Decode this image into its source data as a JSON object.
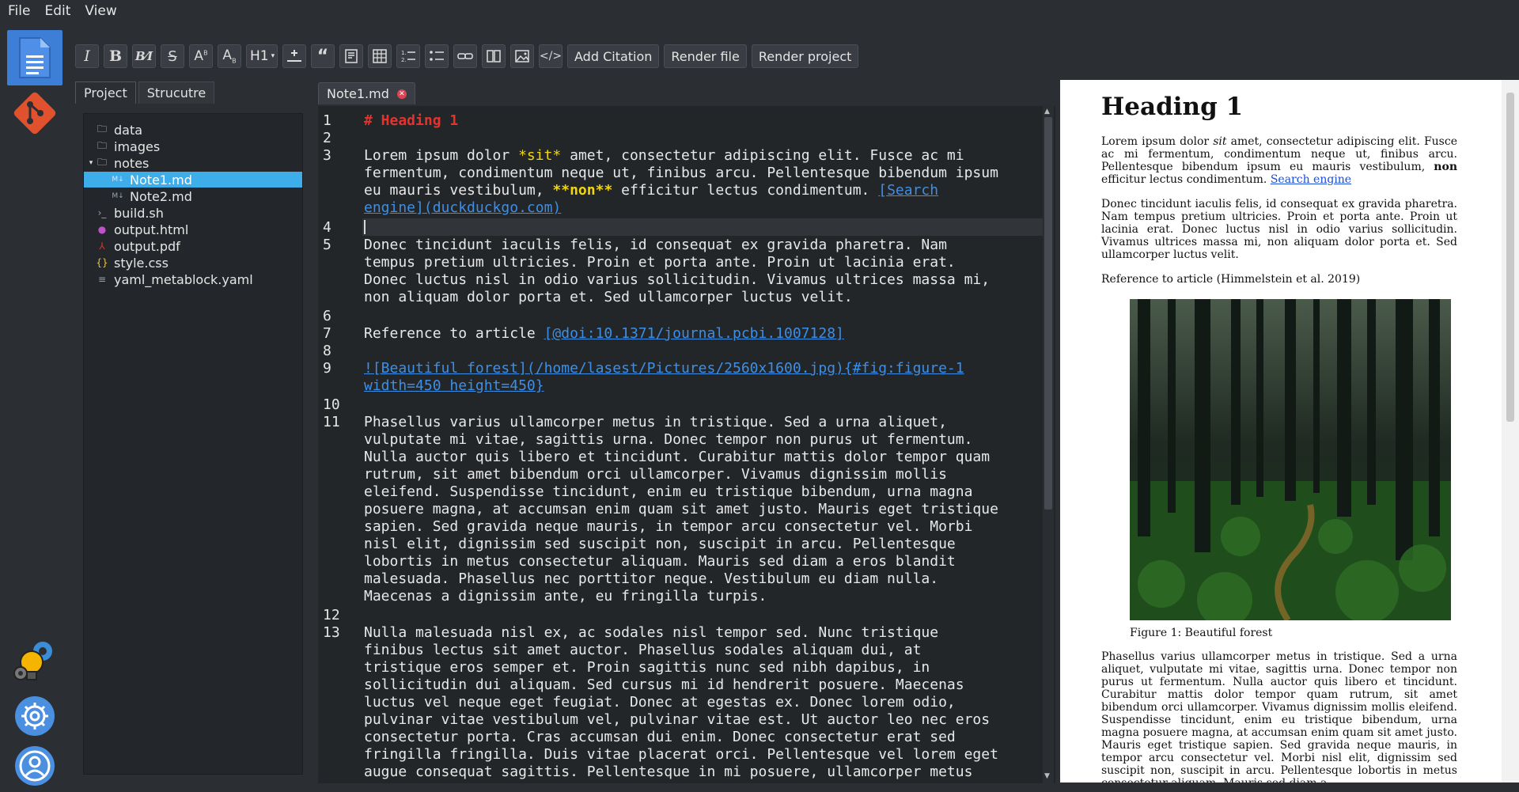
{
  "menubar": {
    "items": [
      "File",
      "Edit",
      "View"
    ]
  },
  "activity": {
    "docs_icon": "document-icon",
    "git_icon": "git-icon",
    "idea_icon": "lightbulb-gear-icon",
    "settings_icon": "gear-icon",
    "user_icon": "user-icon",
    "colors": {
      "docs": "#3d7fd6",
      "git": "#e0512e",
      "settings": "#4a8fe0"
    }
  },
  "toolbar": {
    "heading_label": "H1",
    "add_citation": "Add Citation",
    "render_file": "Render file",
    "render_project": "Render project"
  },
  "project": {
    "tabs": [
      "Project",
      "Strucutre"
    ],
    "tree": [
      {
        "label": "data",
        "icon": "folder-icon"
      },
      {
        "label": "images",
        "icon": "folder-icon"
      },
      {
        "label": "notes",
        "icon": "folder-icon"
      },
      {
        "label": "Note1.md",
        "icon": "markdown-icon",
        "selected": true
      },
      {
        "label": "Note2.md",
        "icon": "markdown-icon"
      },
      {
        "label": "build.sh",
        "icon": "terminal-icon"
      },
      {
        "label": "output.html",
        "icon": "html-icon"
      },
      {
        "label": "output.pdf",
        "icon": "pdf-icon"
      },
      {
        "label": "style.css",
        "icon": "css-icon"
      },
      {
        "label": "yaml_metablock.yaml",
        "icon": "text-file-icon"
      }
    ]
  },
  "editor": {
    "tab_label": "Note1.md",
    "line_numbers": [
      "1",
      "2",
      "3",
      "4",
      "5",
      "6",
      "7",
      "8",
      "9",
      "10",
      "11",
      "12",
      "13"
    ],
    "lines": {
      "l1": "# Heading 1",
      "l3a": "Lorem ipsum dolor ",
      "l3b": "*sit*",
      "l3c": " amet, consectetur adipiscing elit. Fusce ac mi",
      "l3d": "fermentum, condimentum neque ut, finibus arcu. Pellentesque bibendum ipsum",
      "l3e": "eu mauris vestibulum, ",
      "l3f": "**non**",
      "l3g": " efficitur lectus condimentum. ",
      "l3h": "[Search",
      "l3i": "engine](duckduckgo.com)",
      "l5a": "Donec tincidunt iaculis felis, id consequat ex gravida pharetra. Nam",
      "l5b": "tempus pretium ultricies. Proin et porta ante. Proin ut lacinia erat.",
      "l5c": "Donec luctus nisl in odio varius sollicitudin. Vivamus ultrices massa mi,",
      "l5d": "non aliquam dolor porta et. Sed ullamcorper luctus velit.",
      "l7a": "Reference to article ",
      "l7b": "[@doi:10.1371/journal.pcbi.1007128]",
      "l9a": "![Beautiful forest](/home/lasest/Pictures/2560x1600.jpg){#fig:figure-1",
      "l9b": "width=450 height=450}",
      "l11": [
        "Phasellus varius ullamcorper metus in tristique. Sed a urna aliquet,",
        "vulputate mi vitae, sagittis urna. Donec tempor non purus ut fermentum.",
        "Nulla auctor quis libero et tincidunt. Curabitur mattis dolor tempor quam",
        "rutrum, sit amet bibendum orci ullamcorper. Vivamus dignissim mollis",
        "eleifend. Suspendisse tincidunt, enim eu tristique bibendum, urna magna",
        "posuere magna, at accumsan enim quam sit amet justo. Mauris eget tristique",
        "sapien. Sed gravida neque mauris, in tempor arcu consectetur vel. Morbi",
        "nisl elit, dignissim sed suscipit non, suscipit in arcu. Pellentesque",
        "lobortis in metus consectetur aliquam. Mauris sed diam a eros blandit",
        "malesuada. Phasellus nec porttitor neque. Vestibulum eu diam nulla.",
        "Maecenas a dignissim ante, eu fringilla turpis."
      ],
      "l13": [
        "Nulla malesuada nisl ex, ac sodales nisl tempor sed. Nunc tristique",
        "finibus lectus sit amet auctor. Phasellus sodales aliquam dui, at",
        "tristique eros semper et. Proin sagittis nunc sed nibh dapibus, in",
        "sollicitudin dui aliquam. Sed cursus mi id hendrerit posuere. Maecenas",
        "luctus vel neque eget feugiat. Donec at egestas ex. Donec lorem odio,",
        "pulvinar vitae vestibulum vel, pulvinar vitae est. Ut auctor leo nec eros",
        "consectetur porta. Cras accumsan dui enim. Donec consectetur erat sed",
        "fringilla fringilla. Duis vitae placerat orci. Pellentesque vel lorem eget",
        "augue consequat sagittis. Pellentesque in mi posuere, ullamcorper metus"
      ]
    }
  },
  "preview": {
    "heading": "Heading 1",
    "p1a": "Lorem ipsum dolor ",
    "p1_em": "sit",
    "p1b": " amet, consectetur adipiscing elit. Fusce ac mi fermentum, condimentum neque ut, finibus arcu. Pellentesque bibendum ipsum eu mauris vestibulum, ",
    "p1_strong": "non",
    "p1c": " efficitur lectus condimentum. ",
    "p1_link": "Search engine",
    "p2": "Donec tincidunt iaculis felis, id consequat ex gravida pharetra. Nam tempus pretium ultricies. Proin et porta ante. Proin ut lacinia erat. Donec luctus nisl in odio varius sollicitudin. Vivamus ultrices massa mi, non aliquam dolor porta et. Sed ullamcorper luctus velit.",
    "p3": "Reference to article (Himmelstein et al. 2019)",
    "figure_caption": "Figure 1: Beautiful forest",
    "p4": "Phasellus varius ullamcorper metus in tristique. Sed a urna aliquet, vulputate mi vitae, sagittis urna. Donec tempor non purus ut fermentum. Nulla auctor quis libero et tincidunt. Curabitur mattis dolor tempor quam rutrum, sit amet bibendum orci ullamcorper. Vivamus dignissim mollis eleifend. Suspendisse tincidunt, enim eu tristique bibendum, urna magna posuere magna, at accumsan enim quam sit amet justo. Mauris eget tristique sapien. Sed gravida neque mauris, in tempor arcu consectetur vel. Morbi nisl elit, dignissim sed suscipit non, suscipit in arcu. Pellentesque lobortis in metus consectetur aliquam. Mauris sed diam a"
  }
}
